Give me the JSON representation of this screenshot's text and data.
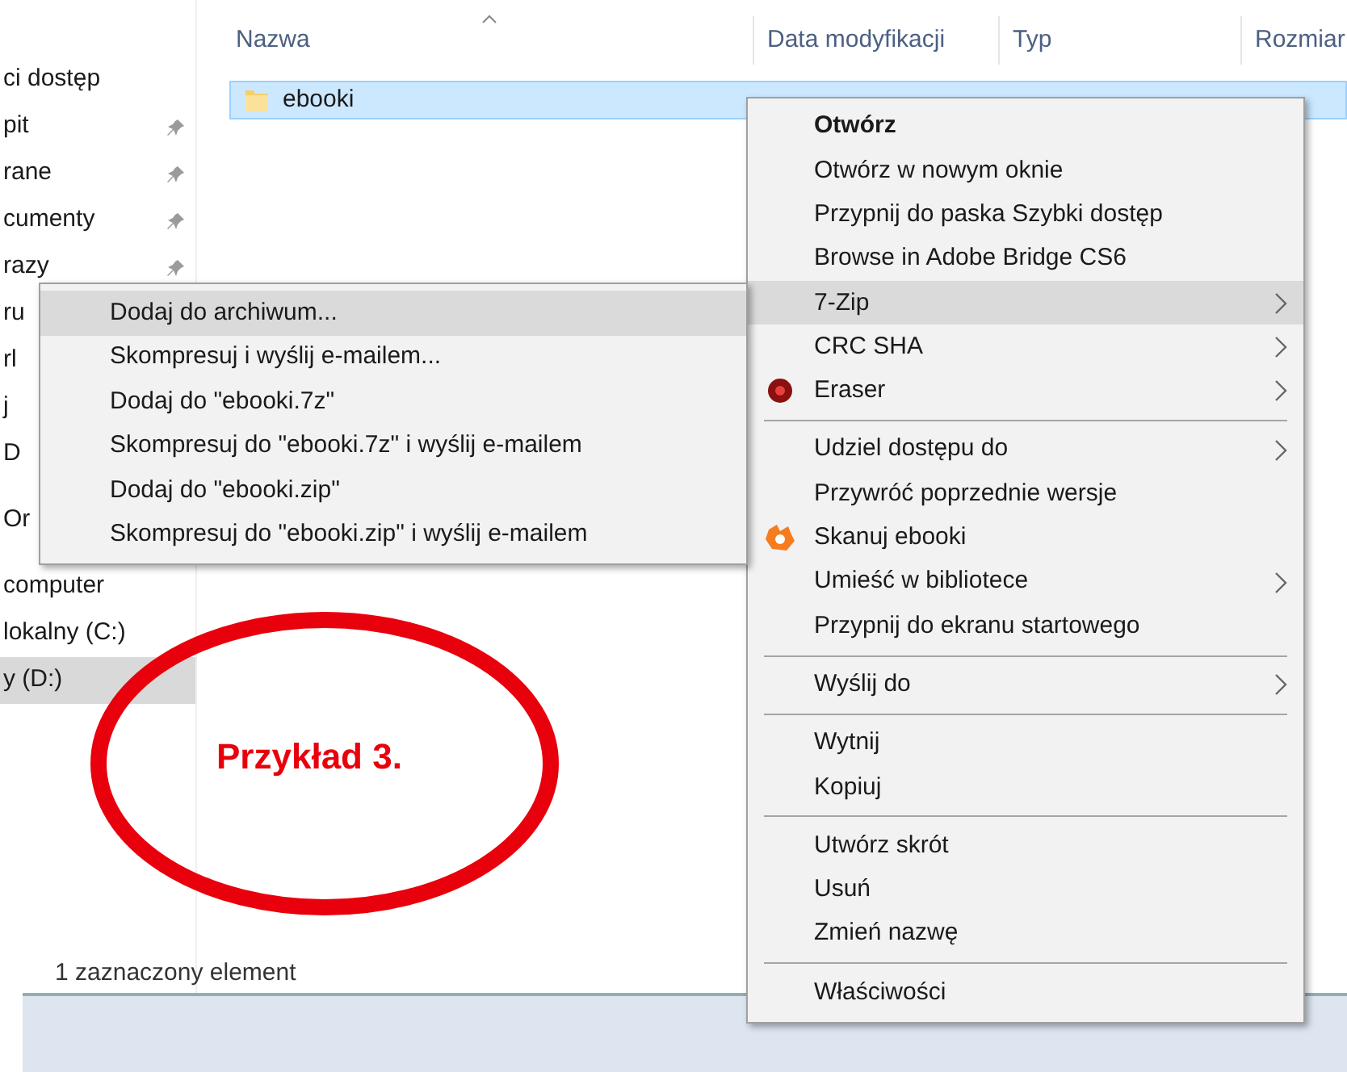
{
  "sidebar": {
    "items": [
      {
        "label": "ci dostęp",
        "pinned": false,
        "selected": false
      },
      {
        "label": "pit",
        "pinned": true,
        "selected": false
      },
      {
        "label": "rane",
        "pinned": true,
        "selected": false
      },
      {
        "label": "cumenty",
        "pinned": true,
        "selected": false
      },
      {
        "label": "razy",
        "pinned": true,
        "selected": false
      },
      {
        "label": "ru",
        "selected": false
      },
      {
        "label": "rl",
        "selected": false
      },
      {
        "label": "j",
        "selected": false
      },
      {
        "label": "D",
        "selected": false
      },
      {
        "label": "Or",
        "selected": false
      },
      {
        "label": "computer",
        "pinned": false,
        "selected": false
      },
      {
        "label": "lokalny (C:)",
        "pinned": false,
        "selected": false
      },
      {
        "label": "y (D:)",
        "pinned": false,
        "selected": true
      }
    ]
  },
  "table": {
    "columns": [
      "Nazwa",
      "Data modyfikacji",
      "Typ",
      "Rozmiar"
    ],
    "rows": [
      {
        "name": "ebooki",
        "selected": true
      }
    ]
  },
  "status_bar": "1 zaznaczony element",
  "context_menu": {
    "entries": [
      {
        "kind": "item",
        "label": "Otwórz",
        "bold": true,
        "submenu": false,
        "selected": false
      },
      {
        "kind": "item",
        "label": "Otwórz w nowym oknie",
        "bold": false,
        "submenu": false,
        "selected": false
      },
      {
        "kind": "item",
        "label": "Przypnij do paska Szybki dostęp",
        "bold": false,
        "submenu": false,
        "selected": false
      },
      {
        "kind": "item",
        "label": "Browse in Adobe Bridge CS6",
        "bold": false,
        "submenu": false,
        "selected": false
      },
      {
        "kind": "item",
        "label": "7-Zip",
        "bold": false,
        "submenu": true,
        "selected": true
      },
      {
        "kind": "item",
        "label": "CRC SHA",
        "bold": false,
        "submenu": true,
        "selected": false
      },
      {
        "kind": "ball",
        "label": "Eraser",
        "bold": false,
        "submenu": true,
        "selected": false
      },
      {
        "kind": "separator"
      },
      {
        "kind": "item",
        "label": "Udziel dostępu do",
        "bold": false,
        "submenu": true,
        "selected": false
      },
      {
        "kind": "item",
        "label": "Przywróć poprzednie wersje",
        "bold": false,
        "submenu": false,
        "selected": false
      },
      {
        "kind": "badge",
        "label": "Skanuj ebooki",
        "bold": false,
        "submenu": false,
        "selected": false
      },
      {
        "kind": "item",
        "label": "Umieść w bibliotece",
        "bold": false,
        "submenu": true,
        "selected": false
      },
      {
        "kind": "item",
        "label": "Przypnij do ekranu startowego",
        "bold": false,
        "submenu": false,
        "selected": false
      },
      {
        "kind": "separator"
      },
      {
        "kind": "item",
        "label": "Wyślij do",
        "bold": false,
        "submenu": true,
        "selected": false
      },
      {
        "kind": "separator"
      },
      {
        "kind": "item",
        "label": "Wytnij",
        "bold": false,
        "submenu": false,
        "selected": false
      },
      {
        "kind": "item",
        "label": "Kopiuj",
        "bold": false,
        "submenu": false,
        "selected": false
      },
      {
        "kind": "separator"
      },
      {
        "kind": "item",
        "label": "Utwórz skrót",
        "bold": false,
        "submenu": false,
        "selected": false
      },
      {
        "kind": "item",
        "label": "Usuń",
        "bold": false,
        "submenu": false,
        "selected": false
      },
      {
        "kind": "item",
        "label": "Zmień nazwę",
        "bold": false,
        "submenu": false,
        "selected": false
      },
      {
        "kind": "separator"
      },
      {
        "kind": "item",
        "label": "Właściwości",
        "bold": false,
        "submenu": false,
        "selected": false
      }
    ]
  },
  "submenu": {
    "items": [
      {
        "label": "Dodaj do archiwum...",
        "selected": true
      },
      {
        "label": "Skompresuj i wyślij e-mailem...",
        "selected": false
      },
      {
        "label": "Dodaj do \"ebooki.7z\"",
        "selected": false
      },
      {
        "label": "Skompresuj do \"ebooki.7z\" i wyślij e-mailem",
        "selected": false
      },
      {
        "label": "Dodaj do \"ebooki.zip\"",
        "selected": false
      },
      {
        "label": "Skompresuj do \"ebooki.zip\" i wyślij e-mailem",
        "selected": false
      }
    ]
  },
  "annotation": {
    "label": "Przykład 3."
  }
}
